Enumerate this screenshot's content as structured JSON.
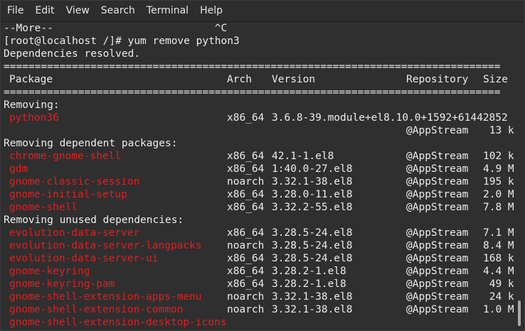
{
  "menu": [
    "File",
    "Edit",
    "View",
    "Search",
    "Terminal",
    "Help"
  ],
  "terminal": {
    "more_prompt": "--More--                          ^C",
    "command": "[root@localhost /]# yum remove python3",
    "deps_resolved": "Dependencies resolved.",
    "separator": "================================================================================",
    "header": {
      "package": "Package",
      "arch": "Arch",
      "version": "Version",
      "repo": "Repository",
      "size": "Size"
    },
    "sections": {
      "removing": "Removing:",
      "dependent": "Removing dependent packages:",
      "unused": "Removing unused dependencies:"
    },
    "removing_pkgs": [
      {
        "name": "python36",
        "arch": "x86_64",
        "version": "3.6.8-39.module+el8.10.0+1592+61442852",
        "repo": "",
        "size": ""
      },
      {
        "name": "",
        "arch": "",
        "version": "",
        "repo": "@AppStream",
        "size": " 13 k"
      }
    ],
    "dependent_pkgs": [
      {
        "name": "chrome-gnome-shell",
        "arch": "x86_64",
        "version": "42.1-1.el8",
        "repo": "@AppStream",
        "size": "102 k"
      },
      {
        "name": "gdm",
        "arch": "x86_64",
        "version": "1:40.0-27.el8",
        "repo": "@AppStream",
        "size": "4.9 M"
      },
      {
        "name": "gnome-classic-session",
        "arch": "noarch",
        "version": "3.32.1-38.el8",
        "repo": "@AppStream",
        "size": "195 k"
      },
      {
        "name": "gnome-initial-setup",
        "arch": "x86_64",
        "version": "3.28.0-11.el8",
        "repo": "@AppStream",
        "size": "2.0 M"
      },
      {
        "name": "gnome-shell",
        "arch": "x86_64",
        "version": "3.32.2-55.el8",
        "repo": "@AppStream",
        "size": "7.8 M"
      }
    ],
    "unused_pkgs": [
      {
        "name": "evolution-data-server",
        "arch": "x86_64",
        "version": "3.28.5-24.el8",
        "repo": "@AppStream",
        "size": "7.1 M"
      },
      {
        "name": "evolution-data-server-langpacks",
        "arch": "noarch",
        "version": "3.28.5-24.el8",
        "repo": "@AppStream",
        "size": "8.4 M"
      },
      {
        "name": "evolution-data-server-ui",
        "arch": "x86_64",
        "version": "3.28.5-24.el8",
        "repo": "@AppStream",
        "size": "168 k"
      },
      {
        "name": "gnome-keyring",
        "arch": "x86_64",
        "version": "3.28.2-1.el8",
        "repo": "@AppStream",
        "size": "4.4 M"
      },
      {
        "name": "gnome-keyring-pam",
        "arch": "x86_64",
        "version": "3.28.2-1.el8",
        "repo": "@AppStream",
        "size": " 49 k"
      },
      {
        "name": "gnome-shell-extension-apps-menu",
        "arch": "noarch",
        "version": "3.32.1-38.el8",
        "repo": "@AppStream",
        "size": " 24 k"
      },
      {
        "name": "gnome-shell-extension-common",
        "arch": "noarch",
        "version": "3.32.1-38.el8",
        "repo": "@AppStream",
        "size": "1.0 M"
      },
      {
        "name": "gnome-shell-extension-desktop-icons",
        "arch": "",
        "version": "",
        "repo": "",
        "size": ""
      }
    ]
  }
}
